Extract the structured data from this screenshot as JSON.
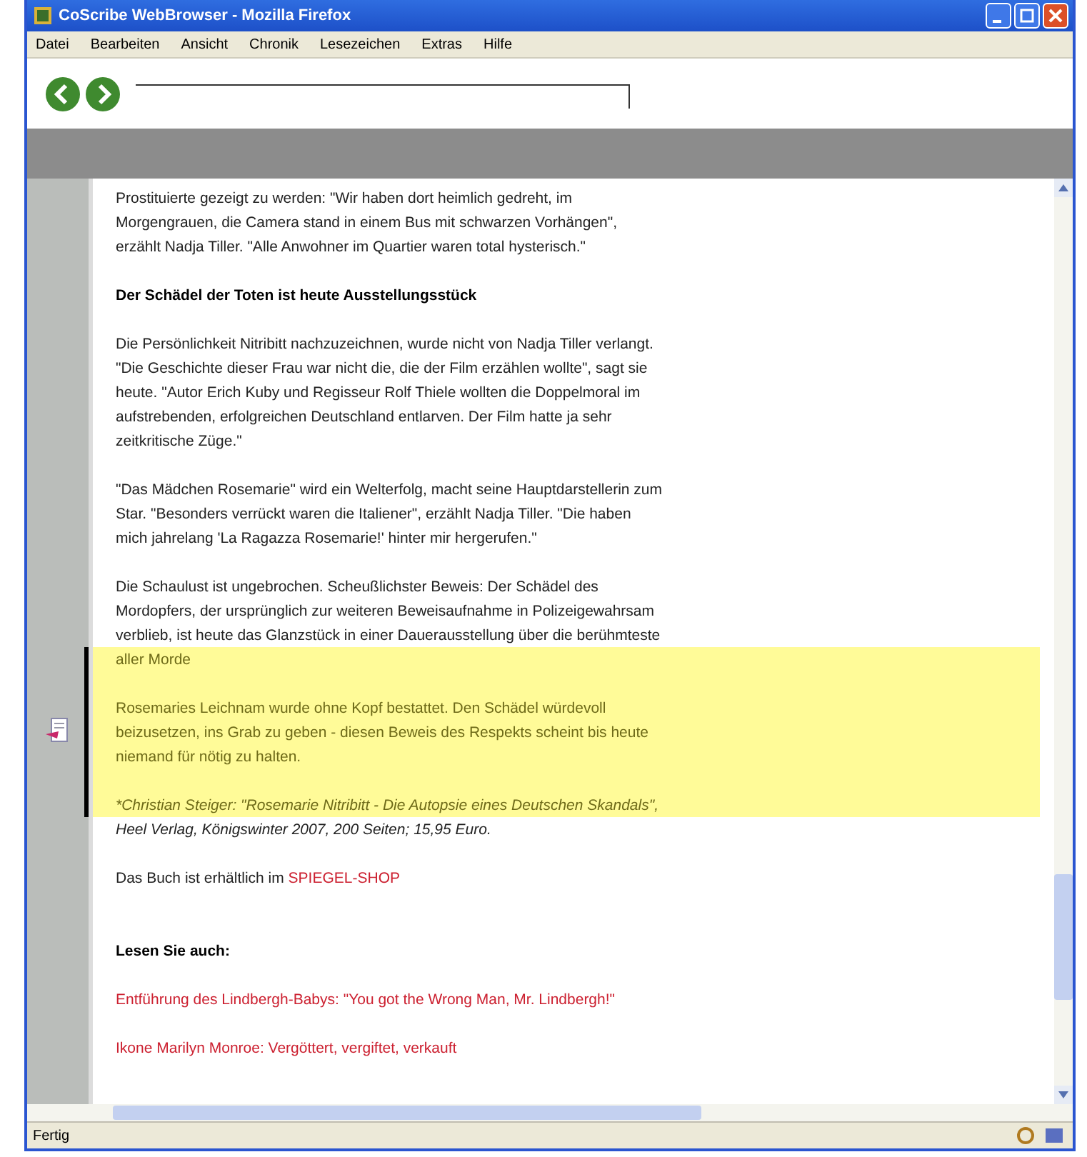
{
  "window": {
    "title": "CoScribe WebBrowser - Mozilla Firefox"
  },
  "menu": [
    "Datei",
    "Bearbeiten",
    "Ansicht",
    "Chronik",
    "Lesezeichen",
    "Extras",
    "Hilfe"
  ],
  "article": [
    {
      "kind": "text",
      "lines": [
        {
          "text": "Prostituierte gezeigt zu werden: \"Wir haben dort heimlich gedreht, im",
          "highlighted": false
        },
        {
          "text": "Morgengrauen, die Camera stand in einem Bus mit schwarzen Vorhängen\",",
          "highlighted": false
        },
        {
          "text": "erzählt Nadja Tiller. \"Alle Anwohner im Quartier waren total hysterisch.\"",
          "highlighted": false
        }
      ]
    },
    {
      "kind": "heading",
      "lines": [
        {
          "text": "Der Schädel der Toten ist heute Ausstellungsstück",
          "highlighted": false
        }
      ]
    },
    {
      "kind": "text",
      "lines": [
        {
          "text": "Die Persönlichkeit Nitribitt nachzuzeichnen, wurde nicht von Nadja Tiller verlangt.",
          "highlighted": false
        },
        {
          "text": "\"Die Geschichte dieser Frau war nicht die, die der Film erzählen wollte\", sagt sie",
          "highlighted": false
        },
        {
          "text": "heute. \"Autor Erich Kuby und Regisseur Rolf Thiele wollten die Doppelmoral im",
          "highlighted": false
        },
        {
          "text": "aufstrebenden, erfolgreichen Deutschland entlarven. Der Film hatte ja sehr",
          "highlighted": false
        },
        {
          "text": "zeitkritische Züge.\"",
          "highlighted": false
        }
      ]
    },
    {
      "kind": "text",
      "lines": [
        {
          "text": "\"Das Mädchen Rosemarie\" wird ein Welterfolg, macht seine Hauptdarstellerin zum",
          "highlighted": false
        },
        {
          "text": "Star. \"Besonders verrückt waren die Italiener\", erzählt Nadja Tiller. \"Die haben",
          "highlighted": false
        },
        {
          "text": "mich jahrelang 'La Ragazza Rosemarie!' hinter mir hergerufen.\"",
          "highlighted": false
        }
      ]
    },
    {
      "kind": "text",
      "lines": [
        {
          "text": "Die Schaulust ist ungebrochen. Scheußlichster Beweis: Der Schädel des",
          "highlighted": false
        },
        {
          "text": "Mordopfers, der ursprünglich zur weiteren Beweisaufnahme in Polizeigewahrsam",
          "highlighted": false
        },
        {
          "text": "verblieb, ist heute das Glanzstück in einer Dauerausstellung über die berühmteste",
          "highlighted": false
        },
        {
          "text": "aller Morde",
          "highlighted": true
        }
      ]
    },
    {
      "kind": "text",
      "lines": [
        {
          "text": "Rosemaries Leichnam wurde ohne Kopf bestattet. Den Schädel würdevoll",
          "highlighted": true
        },
        {
          "text": "beizusetzen, ins Grab zu geben - diesen Beweis des Respekts scheint bis heute",
          "highlighted": true,
          "annotation": true
        },
        {
          "text": "niemand für nötig zu halten.",
          "highlighted": true
        }
      ]
    },
    {
      "kind": "note",
      "lines": [
        {
          "text": "*Christian Steiger: \"Rosemarie Nitribitt - Die Autopsie eines Deutschen Skandals\",",
          "highlighted": true
        },
        {
          "text": "Heel Verlag, Königswinter 2007, 200 Seiten; 15,95 Euro.",
          "highlighted": false
        }
      ]
    },
    {
      "kind": "shop",
      "lines": [
        {
          "text": "Das Buch ist erhältlich im ",
          "link": "SPIEGEL-SHOP",
          "highlighted": false
        }
      ]
    },
    {
      "kind": "heading",
      "lines": [
        {
          "text": "Lesen Sie auch:",
          "highlighted": false
        }
      ]
    },
    {
      "kind": "link",
      "lines": [
        {
          "text": "Entführung des Lindbergh-Babys: \"You got the Wrong Man, Mr. Lindbergh!\"",
          "highlighted": false
        }
      ]
    },
    {
      "kind": "link",
      "lines": [
        {
          "text": "Ikone Marilyn Monroe: Vergöttert, vergiftet, verkauft",
          "highlighted": false
        }
      ]
    }
  ],
  "status_bar": {
    "text": "Fertig"
  }
}
